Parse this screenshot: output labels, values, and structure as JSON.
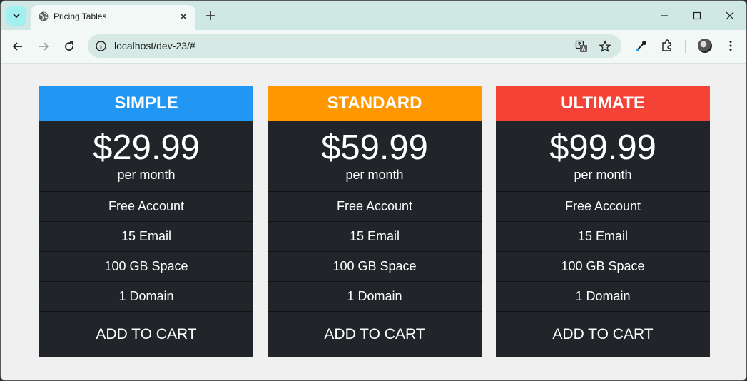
{
  "browser": {
    "tab": {
      "title": "Pricing Tables",
      "favicon": "globe-icon"
    },
    "address_bar": {
      "url": "localhost/dev-23/#"
    },
    "icons": [
      "tab-search-icon",
      "close-icon",
      "plus-icon",
      "minimize-icon",
      "maximize-icon",
      "window-close-icon",
      "back-arrow-icon",
      "forward-arrow-icon",
      "reload-icon",
      "site-info-icon",
      "translate-icon",
      "star-icon",
      "eyedropper-icon",
      "extensions-icon",
      "profile-avatar"
    ]
  },
  "plans": [
    {
      "name": "SIMPLE",
      "color": "#2196f3",
      "price": "$29.99",
      "period": "per month",
      "features": [
        "Free Account",
        "15 Email",
        "100 GB Space",
        "1 Domain"
      ],
      "button": "ADD TO CART"
    },
    {
      "name": "STANDARD",
      "color": "#ff9800",
      "price": "$59.99",
      "period": "per month",
      "features": [
        "Free Account",
        "15 Email",
        "100 GB Space",
        "1 Domain"
      ],
      "button": "ADD TO CART"
    },
    {
      "name": "ULTIMATE",
      "color": "#f44336",
      "price": "$99.99",
      "period": "per month",
      "features": [
        "Free Account",
        "15 Email",
        "100 GB Space",
        "1 Domain"
      ],
      "button": "ADD TO CART"
    }
  ]
}
